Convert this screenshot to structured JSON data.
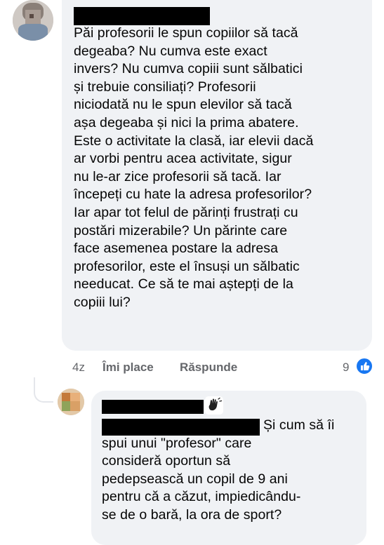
{
  "comment1": {
    "text": "Păi profesorii le spun copiilor să tacă\ndegeaba? Nu cumva este exact\ninvers? Nu cumva copiii sunt sălbatici\nși trebuie consiliați? Profesorii\nniciodată nu le spun elevilor să tacă\nașa degeaba și nici la prima abatere.\nEste o activitate la clasă, iar elevii dacă\nar vorbi pentru acea activitate, sigur\nnu le-ar zice profesorii să tacă. Iar\nîncepeți cu hate la adresa profesorilor?\nIar apar tot felul de părinți frustrați cu\npostări mizerabile? Un părinte care\nface asemenea postare la adresa\nprofesorilor, este el însuși un sălbatic\nneeducat. Ce să te mai aștepți de la\ncopiii lui?",
    "time": "4z",
    "like_label": "Îmi place",
    "reply_label": "Răspunde",
    "reaction_count": "9",
    "reaction_icon": "thumbs-up-icon",
    "avatar_color": "#c4bdb6"
  },
  "comment2": {
    "text": "Și cum să îi\nspui unui \"profesor\" care\nconsideră oportun să\npedepsească un copil de 9 ani\npentru că a căzut, impiedicându-\nse de o bară, la ora de sport?",
    "badge_icon": "waving-hand-icon",
    "avatar_color": "#d9a066"
  },
  "colors": {
    "bubble": "#f0f2f5",
    "meta_text": "#65676b",
    "like_blue": "#1877f2",
    "redaction": "#000000"
  }
}
